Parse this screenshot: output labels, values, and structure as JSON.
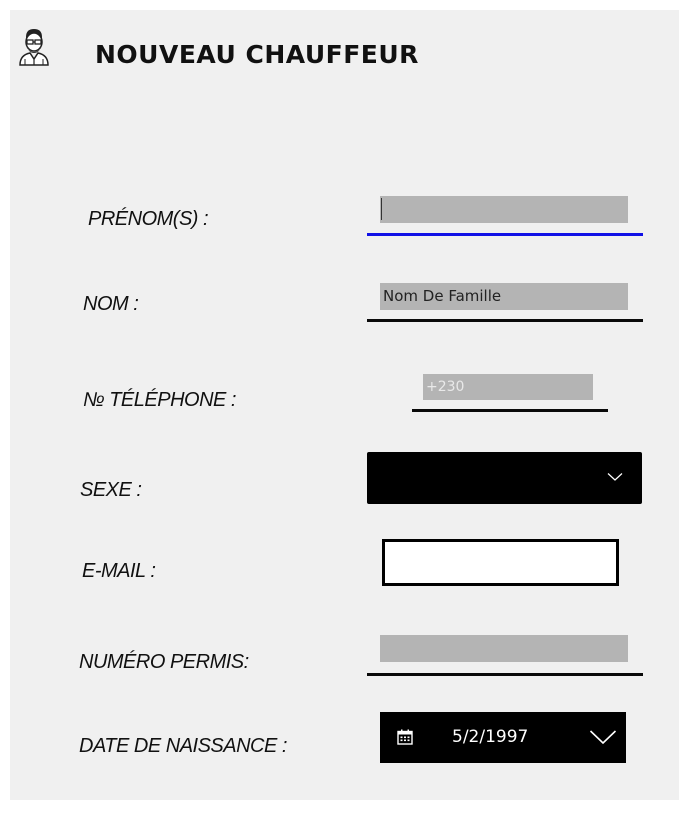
{
  "header": {
    "title": "NOUVEAU CHAUFFEUR",
    "icon": "driver-avatar-icon"
  },
  "form": {
    "prenom": {
      "label": "PRÉNOM(S) :",
      "value": ""
    },
    "nom": {
      "label": "NOM :",
      "value": "Nom De Famille"
    },
    "telephone": {
      "label": "№ TÉLÉPHONE :",
      "value": "+230"
    },
    "sexe": {
      "label": "SEXE :",
      "value": ""
    },
    "email": {
      "label": "E-MAIL :",
      "value": ""
    },
    "permis": {
      "label": "NUMÉRO PERMIS:",
      "value": ""
    },
    "naissance": {
      "label": "DATE DE NAISSANCE :",
      "value": "5/2/1997"
    }
  },
  "colors": {
    "focus_underline": "#1010e6",
    "field_background": "#b4b4b4",
    "panel_background": "#f0f0f0"
  }
}
